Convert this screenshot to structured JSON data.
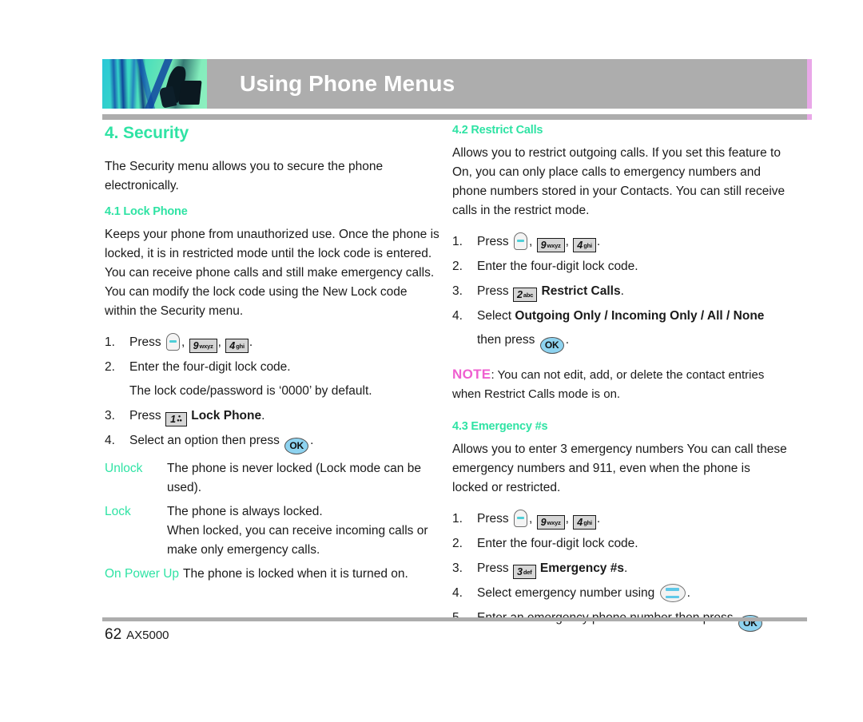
{
  "header": {
    "title": "Using Phone Menus",
    "photo_alt": "abstract-teal-blue-photo"
  },
  "left_column": {
    "section_title": "4. Security",
    "intro": "The Security menu allows you to secure the phone electronically.",
    "lock_phone": {
      "heading": "4.1 Lock Phone",
      "body": "Keeps your phone from unauthorized use. Once the phone is locked, it is in restricted mode until the lock code is entered. You can receive phone calls and still make emergency calls. You can modify the lock code using the New Lock code within the Security menu.",
      "steps": [
        {
          "num": "1.",
          "pre": "Press",
          "keys": [
            "menu-key",
            "9wxyz",
            "4ghi"
          ],
          "post": "."
        },
        {
          "num": "2.",
          "text": "Enter the four-digit lock code.",
          "sub": "The lock code/password is ‘0000’ by default."
        },
        {
          "num": "3.",
          "pre": "Press",
          "key": "1",
          "bold": "Lock Phone",
          "post": "."
        },
        {
          "num": "4.",
          "pre": "Select an option then press",
          "key": "OK",
          "post": "."
        }
      ],
      "options": [
        {
          "term": "Unlock",
          "desc": "The phone is never locked (Lock mode can be used)."
        },
        {
          "term": "Lock",
          "desc": "The phone is always locked.",
          "desc2": "When locked, you can receive incoming calls or make only emergency calls."
        },
        {
          "term": "On Power Up",
          "desc": "The phone is locked when it is turned on."
        }
      ]
    }
  },
  "right_column": {
    "restrict_calls": {
      "heading": "4.2 Restrict Calls",
      "body": "Allows you to restrict outgoing calls. If you set this feature to On, you can only place calls to emergency numbers and phone numbers stored in your Contacts. You can still receive calls in the restrict mode.",
      "steps": [
        {
          "num": "1.",
          "pre": "Press",
          "keys": [
            "menu-key",
            "9wxyz",
            "4ghi"
          ],
          "post": "."
        },
        {
          "num": "2.",
          "text": "Enter the four-digit lock code."
        },
        {
          "num": "3.",
          "pre": "Press",
          "key": "2",
          "bold": "Restrict Calls",
          "post": "."
        },
        {
          "num": "4.",
          "pre": "Select",
          "bold": "Outgoing Only / Incoming Only / All / None",
          "cont_pre": "then press",
          "key": "OK",
          "post": "."
        }
      ],
      "note_label": "NOTE",
      "note_text": ": You can not edit, add, or delete the contact entries when Restrict Calls mode is on."
    },
    "emergency": {
      "heading": "4.3 Emergency #s",
      "body": "Allows you to enter 3 emergency numbers You can call these emergency numbers and 911, even when the phone is locked or restricted.",
      "steps": [
        {
          "num": "1.",
          "pre": "Press",
          "keys": [
            "menu-key",
            "9wxyz",
            "4ghi"
          ],
          "post": "."
        },
        {
          "num": "2.",
          "text": "Enter the four-digit lock code."
        },
        {
          "num": "3.",
          "pre": "Press",
          "key": "3",
          "bold": "Emergency #s",
          "post": "."
        },
        {
          "num": "4.",
          "pre": "Select emergency number using",
          "key": "nav",
          "post": "."
        },
        {
          "num": "5.",
          "pre": "Enter an emergency phone number then press",
          "key": "OK",
          "post": "."
        }
      ]
    }
  },
  "keycaps": {
    "nine": "9",
    "nine_sub": "wxyz",
    "four": "4",
    "four_sub": "ghi",
    "one": "1",
    "one_sub": "••",
    "two": "2",
    "two_sub": "abc",
    "three": "3",
    "three_sub": "def",
    "ok": "OK"
  },
  "footer": {
    "page_number": "62",
    "model": "AX5000"
  },
  "colors": {
    "accent_green": "#2fe3a4",
    "header_gray": "#adadad",
    "note_pink": "#ef5fd0",
    "key_blue": "#8ed3f0"
  }
}
